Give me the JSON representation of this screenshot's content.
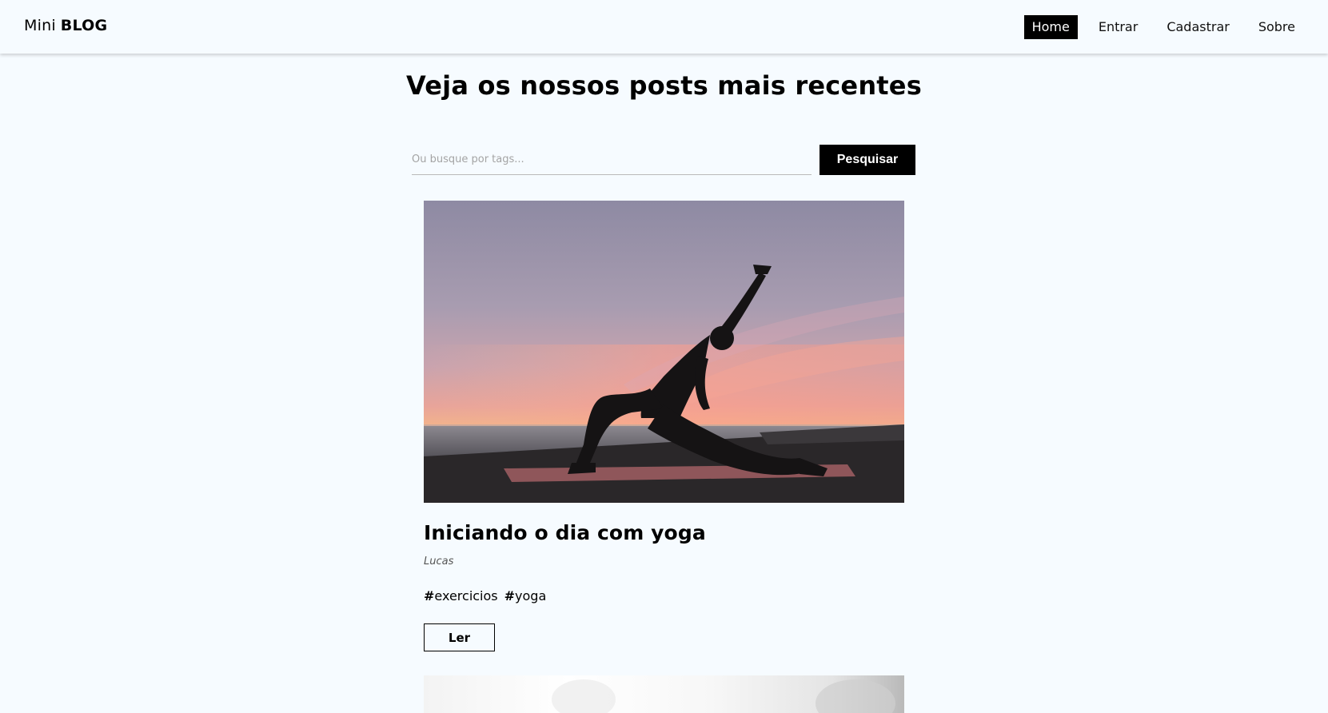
{
  "navbar": {
    "brand_light": "Mini",
    "brand_bold": "BLOG",
    "links": [
      {
        "label": "Home",
        "active": true
      },
      {
        "label": "Entrar",
        "active": false
      },
      {
        "label": "Cadastrar",
        "active": false
      },
      {
        "label": "Sobre",
        "active": false
      }
    ]
  },
  "main": {
    "title": "Veja os nossos posts mais recentes",
    "search": {
      "placeholder": "Ou busque por tags...",
      "button_label": "Pesquisar"
    }
  },
  "posts": [
    {
      "title": "Iniciando o dia com yoga",
      "author": "Lucas",
      "tags": [
        "exercicios",
        "yoga"
      ],
      "read_label": "Ler",
      "image": "yoga-silhouette-sunset"
    }
  ],
  "colors": {
    "background": "#f6fbff",
    "accent": "#000000",
    "active_text": "#ffffff"
  }
}
